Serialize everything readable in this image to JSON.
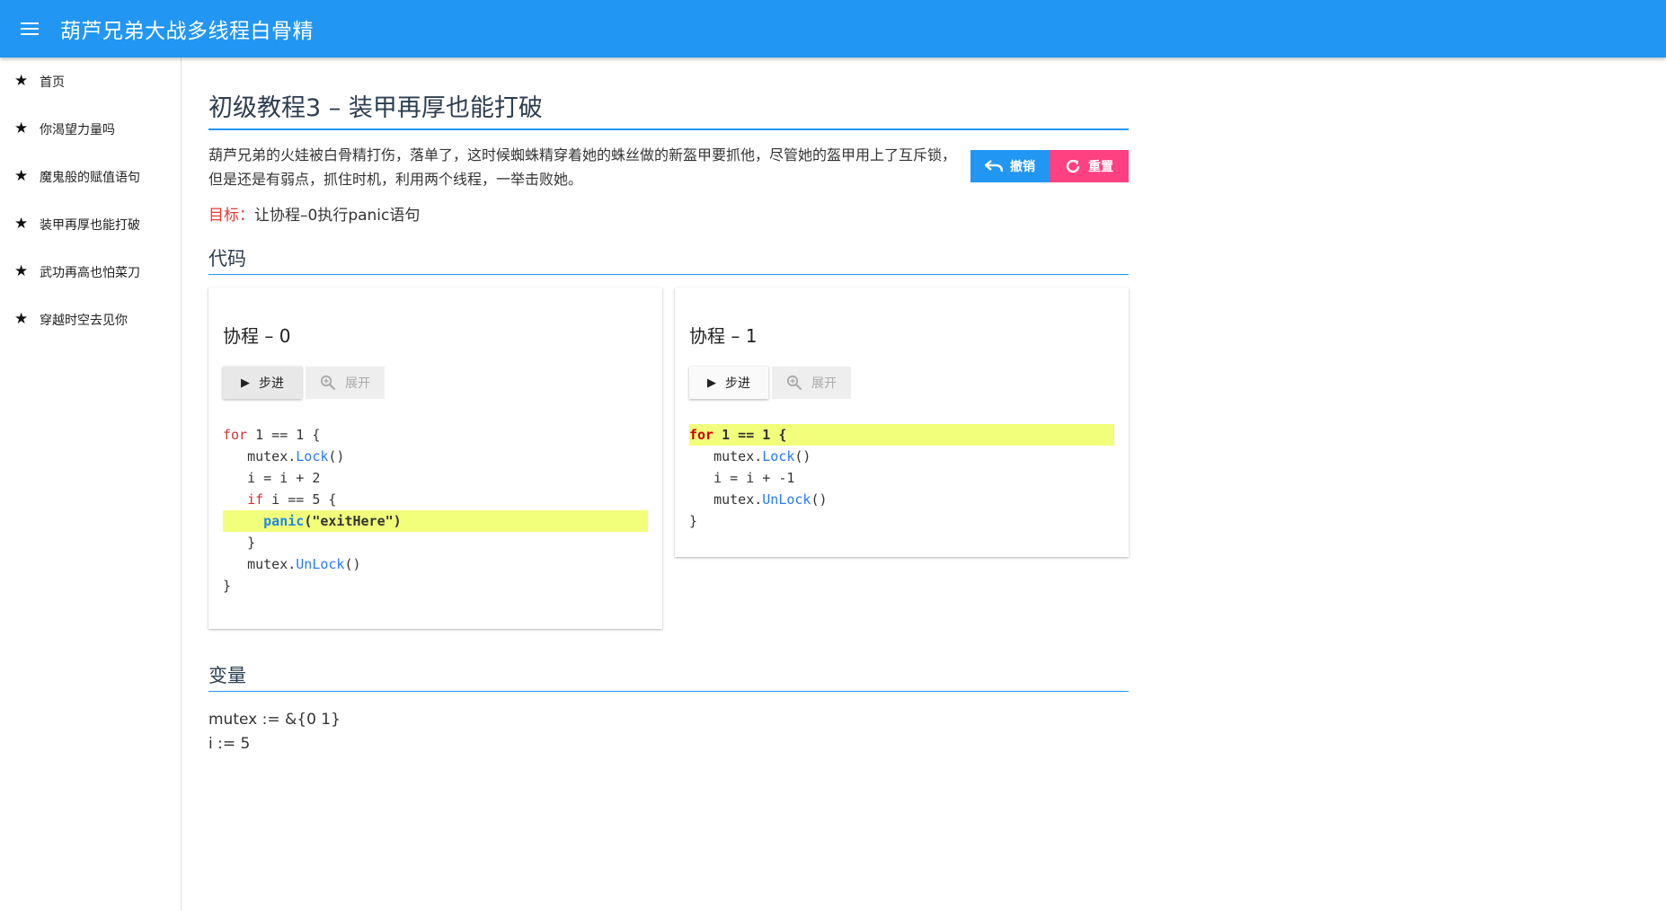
{
  "app": {
    "title": "葫芦兄弟大战多线程白骨精"
  },
  "sidebar": {
    "items": [
      {
        "label": "首页"
      },
      {
        "label": "你渴望力量吗"
      },
      {
        "label": "魔鬼般的赋值语句"
      },
      {
        "label": "装甲再厚也能打破"
      },
      {
        "label": "武功再高也怕菜刀"
      },
      {
        "label": "穿越时空去见你"
      }
    ]
  },
  "page": {
    "title": "初级教程3 – 装甲再厚也能打破",
    "intro": "葫芦兄弟的火娃被白骨精打伤，落单了，这时候蜘蛛精穿着她的蛛丝做的新盔甲要抓他，尽管她的盔甲用上了互斥锁，但是还是有弱点，抓住时机，利用两个线程，一举击败她。",
    "undo_label": "撤销",
    "reset_label": "重置",
    "goal_label": "目标：",
    "goal_text": "让协程–0执行panic语句",
    "code_section": "代码",
    "vars_section": "变量"
  },
  "routines": [
    {
      "title": "协程 – 0",
      "step_label": "步进",
      "expand_label": "展开",
      "code": [
        {
          "indent": "",
          "kw": "for",
          "pre": "",
          "fn": "",
          "rest": " 1 == 1 {"
        },
        {
          "indent": "   ",
          "kw": "",
          "pre": "mutex.",
          "fn": "Lock",
          "rest": "()"
        },
        {
          "indent": "   ",
          "kw": "",
          "pre": "i = i + 2",
          "fn": "",
          "rest": ""
        },
        {
          "indent": "   ",
          "kw": "if",
          "pre": "",
          "fn": "",
          "rest": " i == 5 {"
        },
        {
          "indent": "     ",
          "kw": "",
          "pre": "",
          "fn": "panic",
          "rest": "(\"exitHere\")"
        },
        {
          "indent": "   ",
          "kw": "",
          "pre": "}",
          "fn": "",
          "rest": ""
        },
        {
          "indent": "   ",
          "kw": "",
          "pre": "mutex.",
          "fn": "UnLock",
          "rest": "()"
        },
        {
          "indent": "",
          "kw": "",
          "pre": "}",
          "fn": "",
          "rest": ""
        }
      ],
      "highlight_line": 4
    },
    {
      "title": "协程 – 1",
      "step_label": "步进",
      "expand_label": "展开",
      "code": [
        {
          "indent": "",
          "kw": "for",
          "pre": "",
          "fn": "",
          "rest": " 1 == 1 {"
        },
        {
          "indent": "   ",
          "kw": "",
          "pre": "mutex.",
          "fn": "Lock",
          "rest": "()"
        },
        {
          "indent": "   ",
          "kw": "",
          "pre": "i = i + -1",
          "fn": "",
          "rest": ""
        },
        {
          "indent": "   ",
          "kw": "",
          "pre": "mutex.",
          "fn": "UnLock",
          "rest": "()"
        },
        {
          "indent": "",
          "kw": "",
          "pre": "}",
          "fn": "",
          "rest": ""
        }
      ],
      "highlight_line": 0
    }
  ],
  "variables": [
    "mutex := &{0 1}",
    "i := 5"
  ],
  "colors": {
    "primary": "#2196f3",
    "accent": "#ff4081",
    "highlight": "#f2ff7a",
    "keyword": "#d32f2f",
    "function": "#2979ff"
  }
}
